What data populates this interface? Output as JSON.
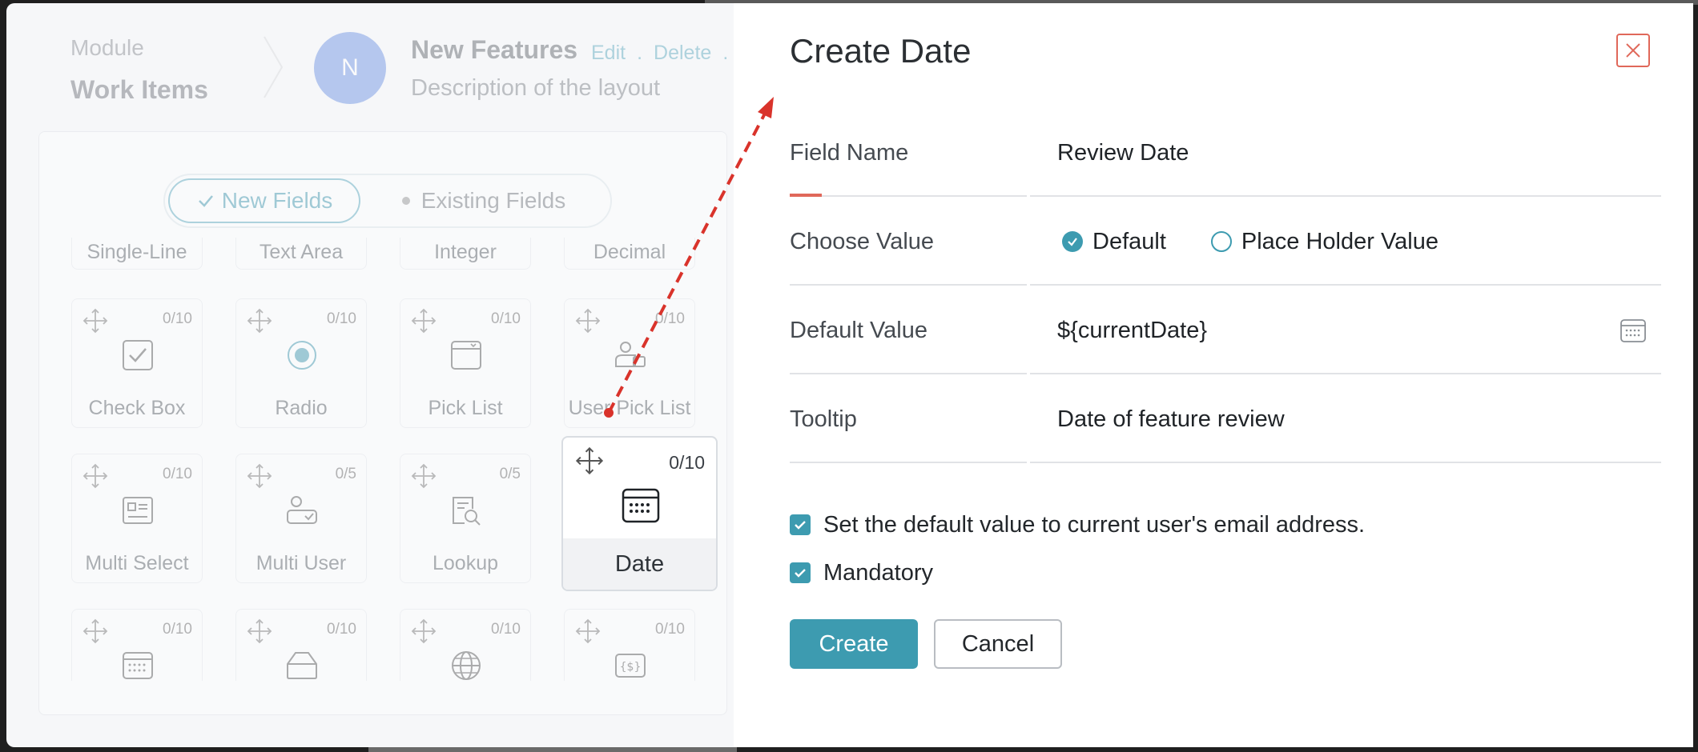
{
  "colors": {
    "accent": "#3d9bb0",
    "danger": "#e0685a",
    "arrow": "#d9332b"
  },
  "left_panel": {
    "module_label": "Module",
    "module_value": "Work Items",
    "avatar_letter": "N",
    "layout_title": "New Features",
    "layout_actions": [
      "Edit",
      ".",
      "Delete",
      "."
    ],
    "layout_description": "Description of the layout",
    "toggle": {
      "new_fields": "New Fields",
      "existing_fields": "Existing Fields"
    },
    "top_row_fields": [
      "Single-Line",
      "Text Area",
      "Integer",
      "Decimal"
    ],
    "tiles_row1": [
      {
        "name": "Check Box",
        "count": "0/10",
        "icon": "checkbox-icon"
      },
      {
        "name": "Radio",
        "count": "0/10",
        "icon": "radio-icon"
      },
      {
        "name": "Pick List",
        "count": "0/10",
        "icon": "picklist-icon"
      },
      {
        "name": "User Pick List",
        "count": "0/10",
        "icon": "user-picklist-icon"
      }
    ],
    "tiles_row2": [
      {
        "name": "Multi Select",
        "count": "0/10",
        "icon": "multi-select-icon"
      },
      {
        "name": "Multi User",
        "count": "0/5",
        "icon": "multi-user-icon"
      },
      {
        "name": "Lookup",
        "count": "0/5",
        "icon": "lookup-icon"
      }
    ],
    "date_tile": {
      "name": "Date",
      "count": "0/10",
      "icon": "calendar-icon"
    },
    "tiles_row3": [
      {
        "count": "0/10",
        "icon": "calendar-icon"
      },
      {
        "count": "0/10",
        "icon": "tag-icon"
      },
      {
        "count": "0/10",
        "icon": "globe-icon"
      },
      {
        "count": "0/10",
        "icon": "currency-icon"
      }
    ]
  },
  "modal": {
    "title": "Create Date",
    "fields": {
      "field_name": {
        "label": "Field Name",
        "value": "Review Date"
      },
      "choose_value": {
        "label": "Choose Value",
        "options": [
          "Default",
          "Place Holder Value"
        ],
        "selected": "Default"
      },
      "default_value": {
        "label": "Default Value",
        "value": "${currentDate}"
      },
      "tooltip": {
        "label": "Tooltip",
        "value": "Date of feature review"
      }
    },
    "checkboxes": [
      {
        "label": "Set the default value to current user's email address.",
        "checked": true
      },
      {
        "label": "Mandatory",
        "checked": true
      }
    ],
    "buttons": {
      "create": "Create",
      "cancel": "Cancel"
    }
  }
}
